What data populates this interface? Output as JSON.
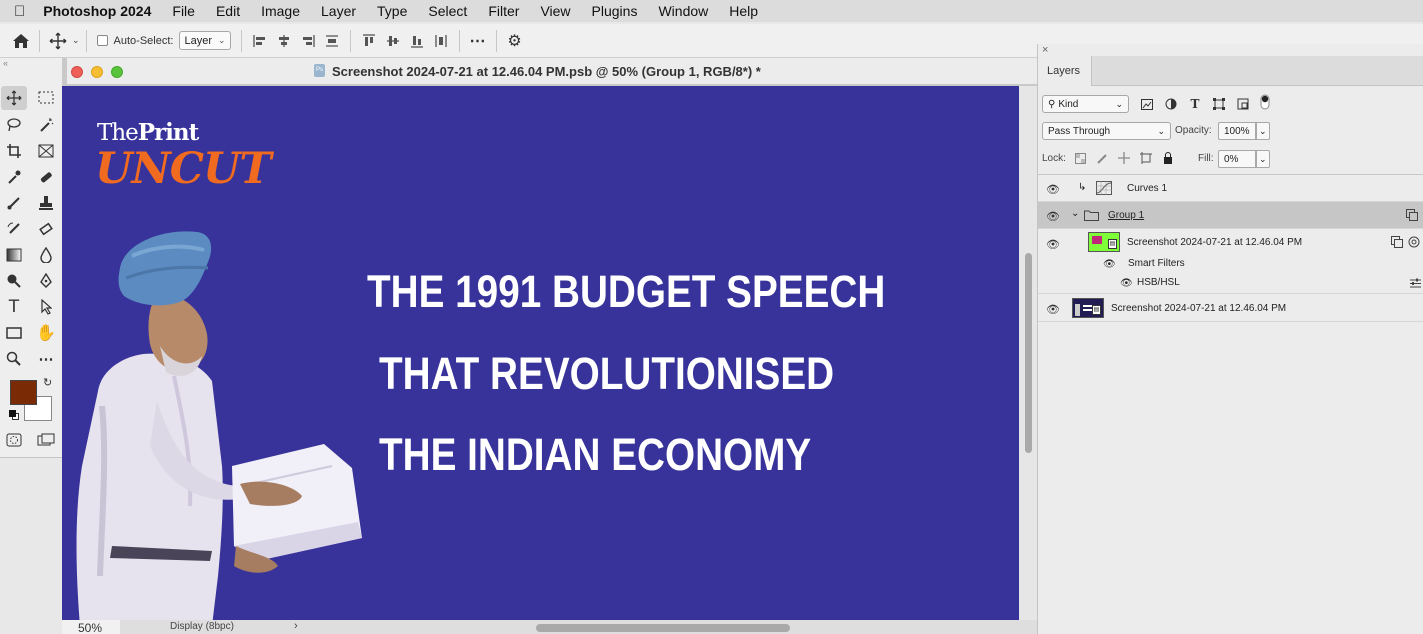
{
  "menubar": {
    "apple_icon": "apple-logo-icon",
    "app_name": "Photoshop 2024",
    "items": [
      "File",
      "Edit",
      "Image",
      "Layer",
      "Type",
      "Select",
      "Filter",
      "View",
      "Plugins",
      "Window",
      "Help"
    ]
  },
  "options_bar": {
    "auto_select_label": "Auto-Select:",
    "auto_select_checked": false,
    "auto_select_target": "Layer",
    "icons": [
      "home-icon",
      "move-tool-icon",
      "align-left-icon",
      "align-center-icon",
      "align-right-icon",
      "distribute-icon",
      "align-top-icon",
      "align-middle-icon",
      "align-bottom-icon",
      "distribute-vertical-icon",
      "more-icon",
      "settings-icon"
    ]
  },
  "tools": {
    "grip": "«",
    "foreground_color": "#7a2a05",
    "background_color": "#ffffff",
    "items": [
      "move-tool-icon",
      "marquee-tool-icon",
      "lasso-tool-icon",
      "magic-wand-icon",
      "crop-tool-icon",
      "frame-tool-icon",
      "eyedropper-icon",
      "healing-brush-icon",
      "brush-tool-icon",
      "stamp-tool-icon",
      "history-brush-icon",
      "eraser-icon",
      "gradient-tool-icon",
      "blur-tool-icon",
      "dodge-tool-icon",
      "pen-tool-icon",
      "type-tool-icon",
      "path-selection-icon",
      "rectangle-tool-icon",
      "hand-tool-icon",
      "zoom-tool-icon",
      "more-tools-icon",
      "quick-mask-icon",
      "screen-mode-icon"
    ]
  },
  "document": {
    "title": "Screenshot 2024-07-21 at 12.46.04 PM.psb @ 50% (Group 1, RGB/8*) *",
    "zoom": "50%",
    "display": "Display (8bpc)",
    "status_arrow": "›",
    "canvas_bg": "#38339a"
  },
  "canvas": {
    "logo_the": "The",
    "logo_print": "Print",
    "logo_uncut": "UNCUT",
    "headline_lines": [
      "THE 1991 BUDGET SPEECH",
      "THAT REVOLUTIONISED",
      "THE INDIAN ECONOMY"
    ]
  },
  "layers_panel": {
    "tab": "Layers",
    "filter_kind": "Kind",
    "blend_mode": "Pass Through",
    "opacity_label": "Opacity:",
    "opacity_value": "100%",
    "lock_label": "Lock:",
    "fill_label": "Fill:",
    "fill_value": "0%",
    "layers": [
      {
        "name": "Curves 1",
        "type": "adjustment",
        "visible": true
      },
      {
        "name": "Group 1",
        "type": "group",
        "visible": true,
        "selected": true
      },
      {
        "name": "Screenshot 2024-07-21 at 12.46.04 PM",
        "type": "smart-object",
        "visible": true
      },
      {
        "name": "Smart Filters",
        "type": "smart-filters",
        "visible": true
      },
      {
        "name": "HSB/HSL",
        "type": "filter",
        "visible": true
      },
      {
        "name": "Screenshot 2024-07-21 at 12.46.04 PM",
        "type": "smart-object",
        "visible": true
      }
    ]
  }
}
